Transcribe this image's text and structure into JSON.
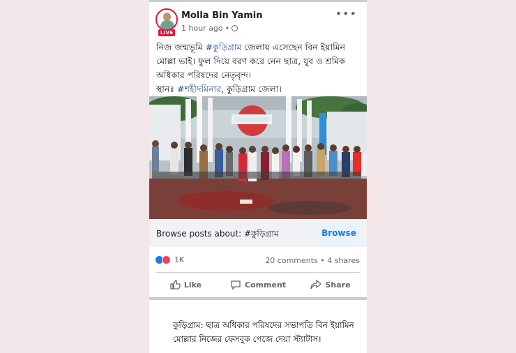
{
  "post": {
    "author": "Molla Bin Yamin",
    "live_badge": "LIVE",
    "time": "1 hour ago",
    "menu_icon": "•••",
    "text_line1_pre": "নিজ জন্মভূমি ",
    "text_line1_hash": "#কুড়িগ্রাম",
    "text_line1_post": " জেলায় এসেছেন  বিন ইয়ামিন মোল্লা ভাই। ফুল দিয়ে বরণ করে নেন ছাত্র, যুব ও শ্রমিক অধিকার পরিষদের নেতৃবৃন্দ।",
    "text_line2_pre": "স্থানঃ ",
    "text_line2_hash": "#শহীদমিনার",
    "text_line2_post": ", কুড়িগ্রাম জেলা।"
  },
  "browse": {
    "label": "Browse posts about: #কুড়িগ্রাম",
    "button": "Browse"
  },
  "stats": {
    "reactions": "1K",
    "comments_shares": "20 comments • 4 shares"
  },
  "actions": {
    "like": "Like",
    "comment": "Comment",
    "share": "Share"
  },
  "caption": "কুড়িগ্রাম: ছাত্র অধিকার পরিষদের সভাপতি বিন ইয়ামিন মোল্লার নিজের ফেসবুক পেজে দেয়া স্ট্যাটাস।",
  "icons": {
    "reaction_like": "like-reaction-icon",
    "reaction_love": "love-reaction-icon",
    "like": "thumbs-up-icon",
    "comment": "comment-bubble-icon",
    "share": "share-arrow-icon",
    "privacy": "globe-icon"
  },
  "colors": {
    "accent": "#1877f2",
    "live": "#e4163f",
    "hashtag": "#385898"
  }
}
